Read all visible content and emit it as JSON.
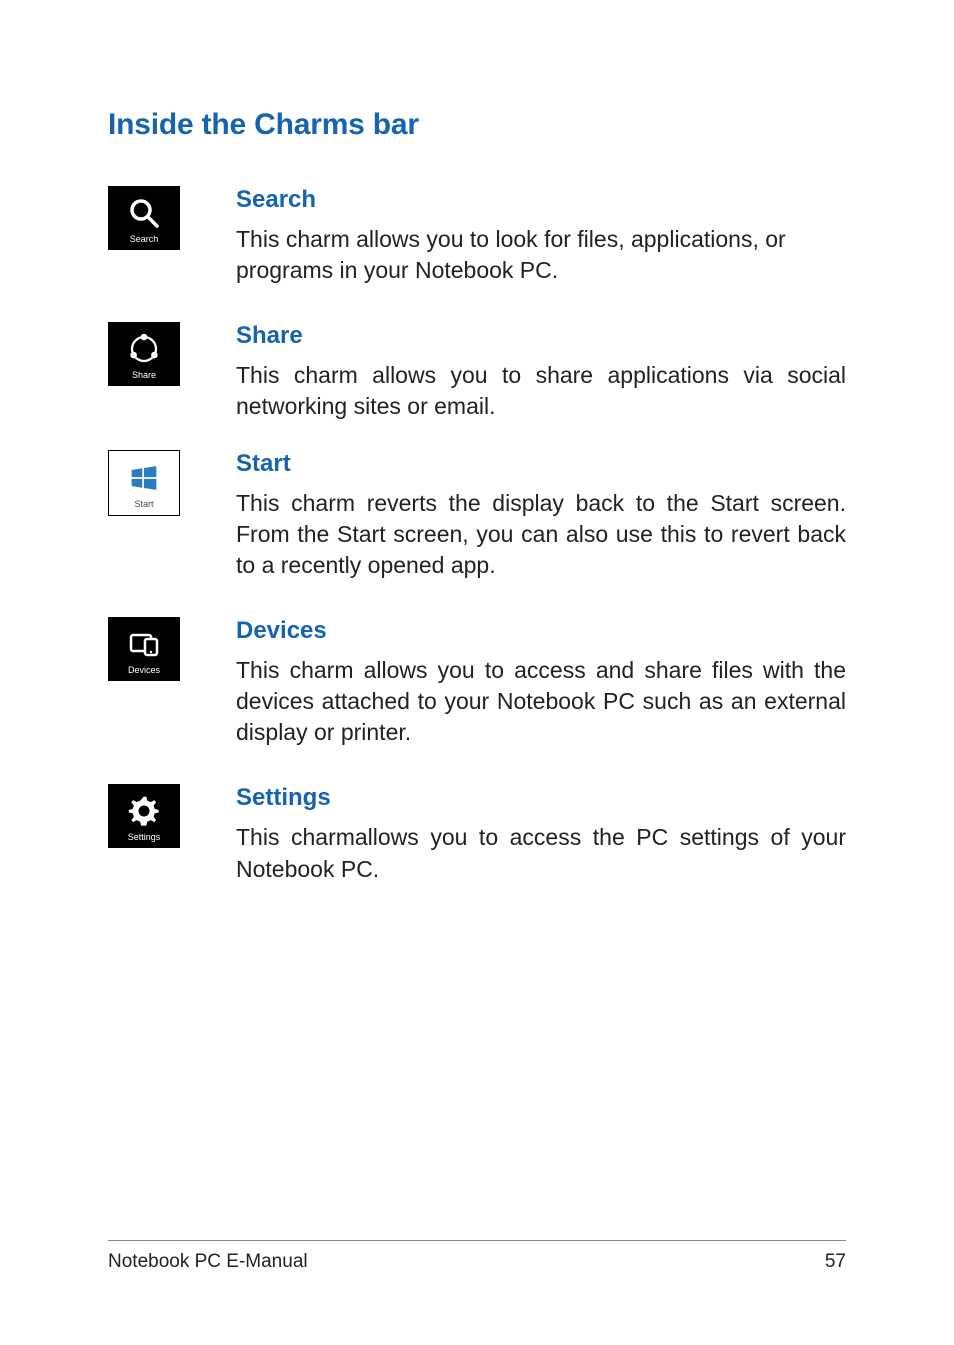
{
  "heading": "Inside the Charms bar",
  "charms": [
    {
      "tile_label": "Search",
      "title": "Search",
      "body": "This charm allows you to look for files, applications, or programs in your Notebook PC.",
      "justify": false
    },
    {
      "tile_label": "Share",
      "title": "Share",
      "body": "This charm allows you to share applications via social networking sites or email.",
      "justify": true
    },
    {
      "tile_label": "Start",
      "title": "Start",
      "body": "This charm reverts the display back to the Start screen. From the Start screen, you can also use this to revert back to a recently opened app.",
      "justify": true
    },
    {
      "tile_label": "Devices",
      "title": "Devices",
      "body": "This charm allows you to access and share files with the devices attached to your Notebook PC such as an external display or printer.",
      "justify": true
    },
    {
      "tile_label": "Settings",
      "title": "Settings",
      "body": "This charmallows you to access the PC settings of your Notebook PC.",
      "justify": true
    }
  ],
  "footer": {
    "left": "Notebook PC E-Manual",
    "right": "57"
  }
}
